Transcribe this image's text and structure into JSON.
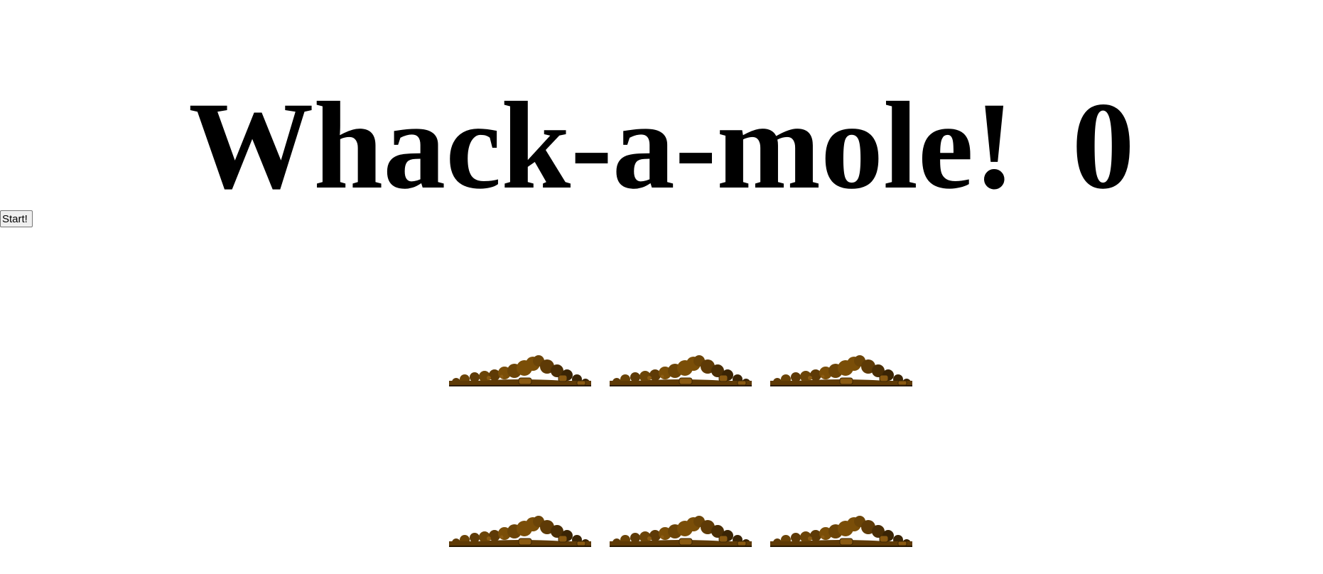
{
  "game": {
    "title": "Whack-a-mole!",
    "score": "0"
  },
  "controls": {
    "start_label": "Start!"
  },
  "board": {
    "holes": 6,
    "dirt_icon": "dirt-mound-icon",
    "colors": {
      "dirt_light": "#7A4E08",
      "dirt_mid": "#5E3A06",
      "dirt_dark": "#3A2404",
      "rock": "#8A5A12"
    }
  }
}
